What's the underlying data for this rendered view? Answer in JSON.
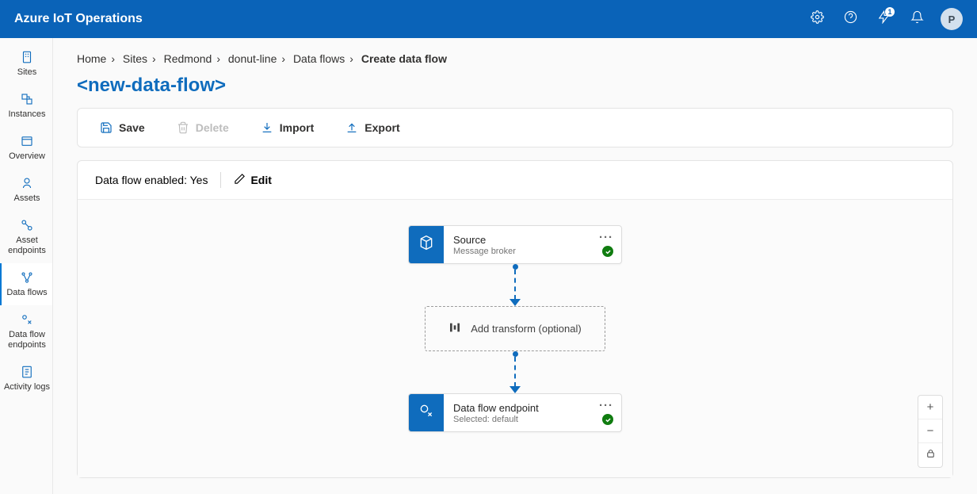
{
  "app_title": "Azure IoT Operations",
  "notification_count": "1",
  "avatar_initial": "P",
  "breadcrumb": {
    "items": [
      {
        "label": "Home"
      },
      {
        "label": "Sites"
      },
      {
        "label": "Redmond"
      },
      {
        "label": "donut-line"
      },
      {
        "label": "Data flows"
      }
    ],
    "current": "Create data flow"
  },
  "page_title": "<new-data-flow>",
  "toolbar": {
    "save": "Save",
    "delete": "Delete",
    "import": "Import",
    "export": "Export"
  },
  "status": {
    "enabled_text": "Data flow enabled: Yes",
    "edit": "Edit"
  },
  "nodes": {
    "source": {
      "title": "Source",
      "sub": "Message broker"
    },
    "transform": {
      "label": "Add transform (optional)"
    },
    "endpoint": {
      "title": "Data flow endpoint",
      "sub": "Selected: default"
    }
  },
  "sidebar": {
    "items": [
      {
        "label": "Sites"
      },
      {
        "label": "Instances"
      },
      {
        "label": "Overview"
      },
      {
        "label": "Assets"
      },
      {
        "label": "Asset endpoints"
      },
      {
        "label": "Data flows"
      },
      {
        "label": "Data flow endpoints"
      },
      {
        "label": "Activity logs"
      }
    ]
  }
}
